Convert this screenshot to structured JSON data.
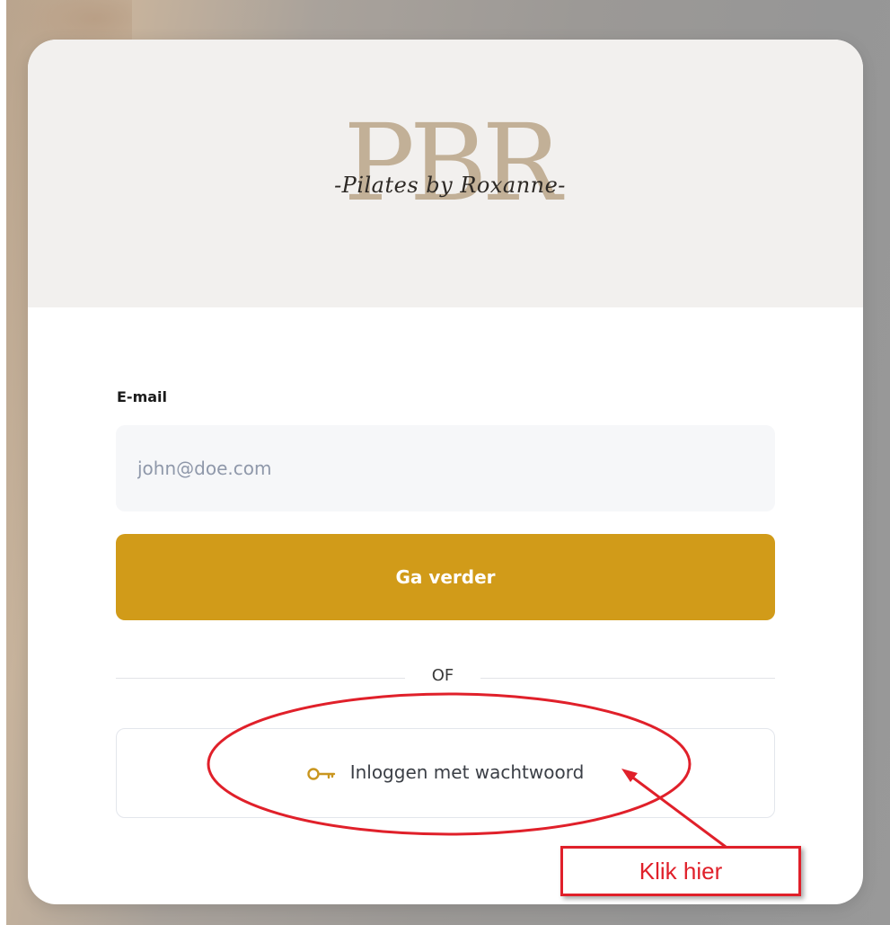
{
  "logo": {
    "monogram": "PBR",
    "script": "-Pilates by Roxanne-",
    "monogram_color": "#c2b097"
  },
  "form": {
    "email_label": "E-mail",
    "email_placeholder": "john@doe.com",
    "email_value": "",
    "continue_label": "Ga verder",
    "divider_text": "OF",
    "password_login_label": "Inloggen met wachtwoord"
  },
  "annotation": {
    "callout_text": "Klik hier",
    "color": "#e0202a"
  },
  "colors": {
    "accent": "#d19b19",
    "key_icon": "#c9961f",
    "header_bg": "#f2f0ee"
  },
  "icons": {
    "password_button_icon": "key-icon"
  }
}
